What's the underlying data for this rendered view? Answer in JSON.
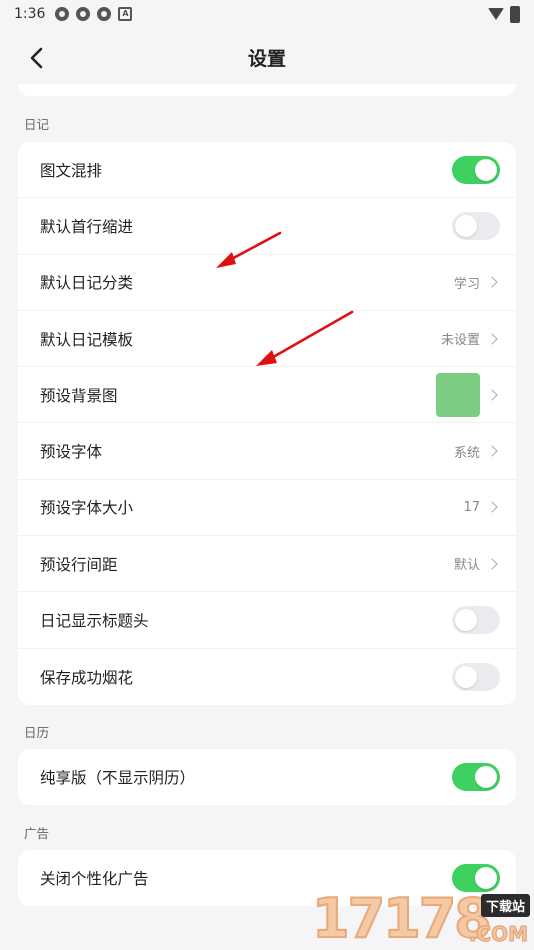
{
  "status_bar": {
    "time": "1:36",
    "icon_letter": "A"
  },
  "header": {
    "title": "设置"
  },
  "sections": {
    "diary": {
      "label": "日记",
      "rows": [
        {
          "label": "图文混排",
          "type": "toggle",
          "on": true
        },
        {
          "label": "默认首行缩进",
          "type": "toggle",
          "on": false
        },
        {
          "label": "默认日记分类",
          "type": "value",
          "value": "学习"
        },
        {
          "label": "默认日记模板",
          "type": "value",
          "value": "未设置"
        },
        {
          "label": "预设背景图",
          "type": "image"
        },
        {
          "label": "预设字体",
          "type": "value",
          "value": "系统"
        },
        {
          "label": "预设字体大小",
          "type": "value",
          "value": "17"
        },
        {
          "label": "预设行间距",
          "type": "value",
          "value": "默认"
        },
        {
          "label": "日记显示标题头",
          "type": "toggle",
          "on": false
        },
        {
          "label": "保存成功烟花",
          "type": "toggle",
          "on": false
        }
      ]
    },
    "calendar": {
      "label": "日历",
      "rows": [
        {
          "label": "纯享版（不显示阴历）",
          "type": "toggle",
          "on": true
        }
      ]
    },
    "ads": {
      "label": "广告",
      "rows": [
        {
          "label": "关闭个性化广告",
          "type": "toggle",
          "on": true
        }
      ]
    }
  },
  "colors": {
    "toggle_on": "#3ed160",
    "toggle_off": "#ebebef",
    "annotation_arrow": "#e01010"
  },
  "watermark": {
    "digits": "17178",
    "tag": "下载站",
    "suffix": ".COM"
  }
}
